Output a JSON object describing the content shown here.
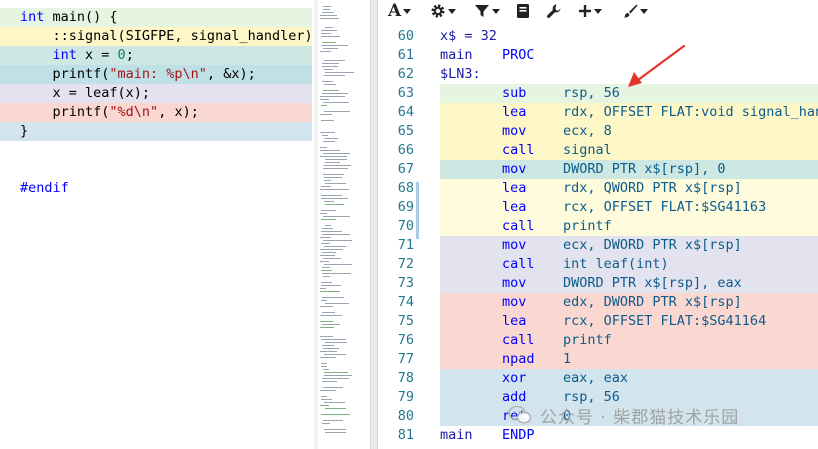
{
  "colors": {
    "green": "#e6f5e1",
    "yellow": "#fdf6c6",
    "teal": "#cde8e3",
    "lavender": "#e3e3ef",
    "salmon": "#fad7d1",
    "blue": "#d2e4ee",
    "arrow": "#e5342b"
  },
  "source": {
    "lines": [
      {
        "text": "int main() {",
        "bg": "green"
      },
      {
        "text": "    ::signal(SIGFPE, signal_handler);",
        "bg": "yellow"
      },
      {
        "text": "    int x = 0;",
        "bg": "teal"
      },
      {
        "text": "    printf(\"main: %p\\n\", &x);",
        "bg": "blueTeal"
      },
      {
        "text": "    x = leaf(x);",
        "bg": "lavender"
      },
      {
        "text": "    printf(\"%d\\n\", x);",
        "bg": "salmon"
      },
      {
        "text": "}",
        "bg": "blue"
      },
      {
        "text": "",
        "bg": "none"
      },
      {
        "text": "",
        "bg": "none"
      },
      {
        "text": "#endif",
        "bg": "none"
      }
    ]
  },
  "toolbar": {
    "items": [
      {
        "icon": "font-icon",
        "label": "A"
      },
      {
        "icon": "gear-icon",
        "label": "⚙"
      },
      {
        "icon": "filter-icon",
        "label": "▼"
      },
      {
        "icon": "book-icon",
        "label": "▮"
      },
      {
        "icon": "wrench-icon",
        "label": "🔧"
      },
      {
        "icon": "plus-icon",
        "label": "+"
      },
      {
        "icon": "brush-icon",
        "label": "✎"
      }
    ]
  },
  "asm": {
    "lines": [
      {
        "n": "60",
        "c0": "x$ = 32",
        "c1": "",
        "c2": "",
        "bg": "none"
      },
      {
        "n": "61",
        "c0": "main",
        "c1": "PROC",
        "c2": "",
        "bg": "none",
        "c1at": "c1p"
      },
      {
        "n": "62",
        "c0": "$LN3:",
        "c1": "",
        "c2": "",
        "bg": "none"
      },
      {
        "n": "63",
        "c0": "",
        "c1": "sub",
        "c2": "rsp, 56",
        "bg": "green"
      },
      {
        "n": "64",
        "c0": "",
        "c1": "lea",
        "c2": "rdx, OFFSET FLAT:void signal_handler",
        "bg": "yellow"
      },
      {
        "n": "65",
        "c0": "",
        "c1": "mov",
        "c2": "ecx, 8",
        "bg": "yellow"
      },
      {
        "n": "66",
        "c0": "",
        "c1": "call",
        "c2": "signal",
        "bg": "yellow"
      },
      {
        "n": "67",
        "c0": "",
        "c1": "mov",
        "c2": "DWORD PTR x$[rsp], 0",
        "bg": "teal"
      },
      {
        "n": "68",
        "c0": "",
        "c1": "lea",
        "c2": "rdx, QWORD PTR x$[rsp]",
        "bg": "yellowLight"
      },
      {
        "n": "69",
        "c0": "",
        "c1": "lea",
        "c2": "rcx, OFFSET FLAT:$SG41163",
        "bg": "yellowLight"
      },
      {
        "n": "70",
        "c0": "",
        "c1": "call",
        "c2": "printf",
        "bg": "yellowLight"
      },
      {
        "n": "71",
        "c0": "",
        "c1": "mov",
        "c2": "ecx, DWORD PTR x$[rsp]",
        "bg": "lavender"
      },
      {
        "n": "72",
        "c0": "",
        "c1": "call",
        "c2": "int leaf(int)",
        "bg": "lavender"
      },
      {
        "n": "73",
        "c0": "",
        "c1": "mov",
        "c2": "DWORD PTR x$[rsp], eax",
        "bg": "lavender"
      },
      {
        "n": "74",
        "c0": "",
        "c1": "mov",
        "c2": "edx, DWORD PTR x$[rsp]",
        "bg": "salmon"
      },
      {
        "n": "75",
        "c0": "",
        "c1": "lea",
        "c2": "rcx, OFFSET FLAT:$SG41164",
        "bg": "salmon"
      },
      {
        "n": "76",
        "c0": "",
        "c1": "call",
        "c2": "printf",
        "bg": "salmon"
      },
      {
        "n": "77",
        "c0": "",
        "c1": "npad",
        "c2": "1",
        "bg": "salmon"
      },
      {
        "n": "78",
        "c0": "",
        "c1": "xor",
        "c2": "eax, eax",
        "bg": "blue"
      },
      {
        "n": "79",
        "c0": "",
        "c1": "add",
        "c2": "rsp, 56",
        "bg": "blue"
      },
      {
        "n": "80",
        "c0": "",
        "c1": "ret",
        "c2": "0",
        "bg": "blue"
      },
      {
        "n": "81",
        "c0": "main",
        "c1": "ENDP",
        "c2": "",
        "bg": "none",
        "c1at": "c1p"
      }
    ]
  },
  "watermark": {
    "text": "公众号 · 柴郡猫技术乐园"
  }
}
